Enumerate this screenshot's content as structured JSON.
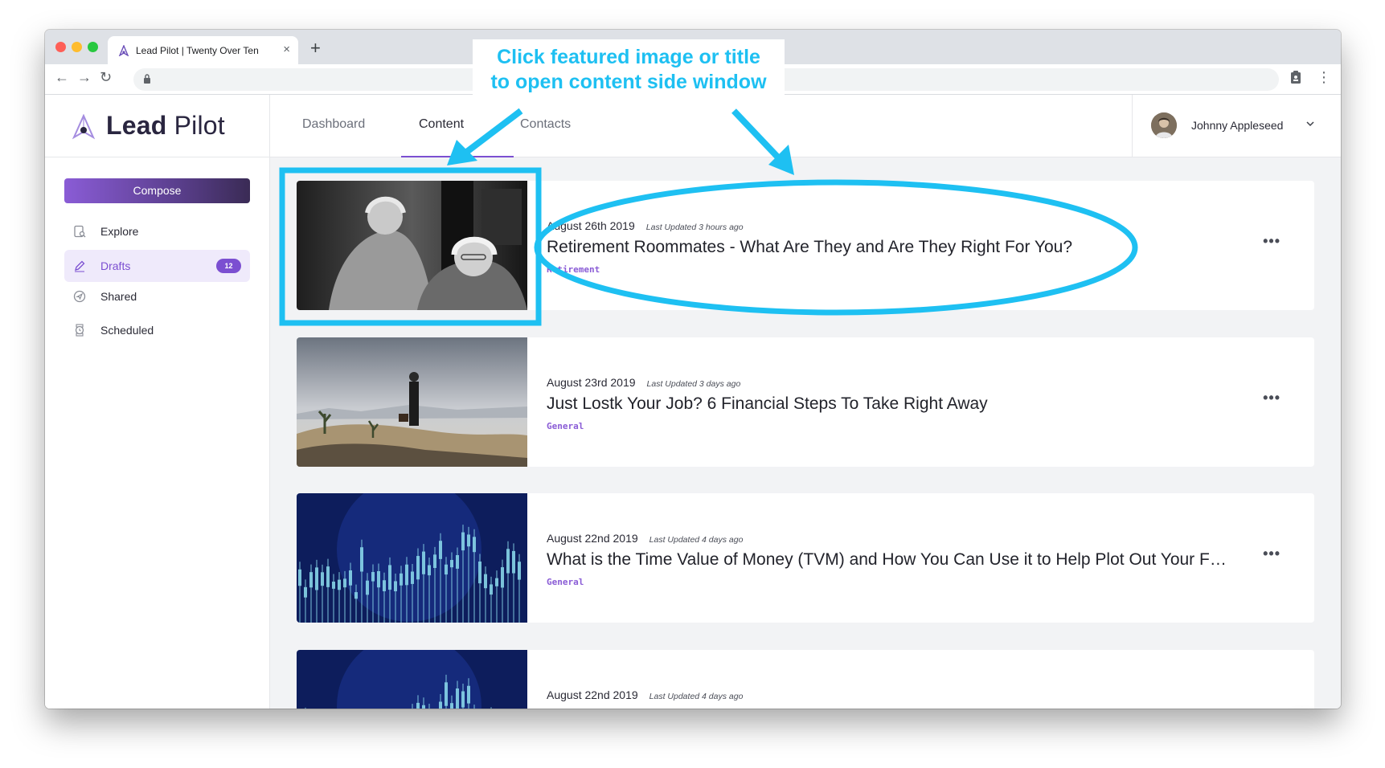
{
  "browser": {
    "tab_title": "Lead Pilot | Twenty Over Ten",
    "tab_close": "×",
    "new_tab": "+",
    "back": "←",
    "forward": "→",
    "reload": "↻",
    "menu": "⋮"
  },
  "brand": {
    "name_bold": "Lead",
    "name_light": " Pilot"
  },
  "sidebar": {
    "compose_label": "Compose",
    "items": [
      {
        "label": "Explore",
        "icon": "explore-icon"
      },
      {
        "label": "Drafts",
        "icon": "pencil-icon",
        "badge": "12",
        "active": true
      },
      {
        "label": "Shared",
        "icon": "send-icon"
      },
      {
        "label": "Scheduled",
        "icon": "watch-icon"
      }
    ]
  },
  "topnav": {
    "tabs": [
      {
        "label": "Dashboard"
      },
      {
        "label": "Content",
        "active": true
      },
      {
        "label": "Contacts"
      }
    ],
    "user_name": "Johnny Appleseed"
  },
  "cards": [
    {
      "date": "August 26th 2019",
      "updated": "Last Updated 3 hours ago",
      "title": "Retirement Roommates - What Are They and Are They Right For You?",
      "tag": "Retirement",
      "more": "•••"
    },
    {
      "date": "August 23rd 2019",
      "updated": "Last Updated 3 days ago",
      "title": "Just Lostk Your Job? 6 Financial Steps To Take Right Away",
      "tag": "General",
      "more": "•••"
    },
    {
      "date": "August 22nd 2019",
      "updated": "Last Updated 4 days ago",
      "title": "What is the Time Value of Money (TVM) and How You Can Use it to Help Plot Out Your Future",
      "tag": "General",
      "more": "•••"
    },
    {
      "date": "August 22nd 2019",
      "updated": "Last Updated 4 days ago",
      "title": "",
      "tag": "",
      "more": ""
    }
  ],
  "annotation": {
    "line1": "Click featured image or title",
    "line2": "to open content side window",
    "color": "#1ec0f2"
  },
  "colors": {
    "accent": "#7b4fd1",
    "annotation": "#1ec0f2"
  }
}
